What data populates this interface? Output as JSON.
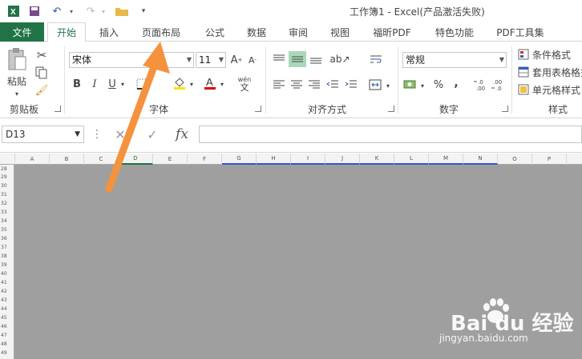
{
  "window_title": "工作簿1 - Excel(产品激活失败)",
  "tabs": [
    "开始",
    "插入",
    "页面布局",
    "公式",
    "数据",
    "审阅",
    "视图",
    "福昕PDF",
    "特色功能",
    "PDF工具集"
  ],
  "file_tab": "文件",
  "clipboard": {
    "paste": "粘贴",
    "group": "剪贴板"
  },
  "font": {
    "name": "宋体",
    "size": "11",
    "group": "字体",
    "bold": "B",
    "italic": "I",
    "underline": "U",
    "font_color": "A",
    "phonetic_top": "wén",
    "phonetic_bottom": "文"
  },
  "alignment": {
    "group": "对齐方式"
  },
  "number": {
    "format": "常规",
    "group": "数字",
    "percent": "%",
    "comma": ",",
    "inc_decimal": "←.0\n.00",
    "dec_decimal": ".00\n→.0"
  },
  "styles": {
    "conditional": "条件格式",
    "table_format": "套用表格格式",
    "cell_styles": "单元格样式",
    "group": "样式"
  },
  "formula_bar": {
    "name_box": "D13",
    "fx": "fx",
    "formula": ""
  },
  "columns": [
    "A",
    "B",
    "C",
    "D",
    "E",
    "F",
    "G",
    "H",
    "I",
    "J",
    "K",
    "L",
    "M",
    "N",
    "O",
    "P"
  ],
  "rows": [
    "28",
    "29",
    "30",
    "31",
    "32",
    "33",
    "34",
    "35",
    "36",
    "37",
    "38",
    "39",
    "40",
    "41",
    "42",
    "43",
    "44",
    "45",
    "46",
    "47",
    "48",
    "49"
  ],
  "watermark": {
    "brand": "Bai du 经验",
    "url": "jingyan.baidu.com"
  },
  "colors": {
    "excel_green": "#217346",
    "arrow": "#f5923e",
    "sheet_gray": "#9f9f9f"
  }
}
